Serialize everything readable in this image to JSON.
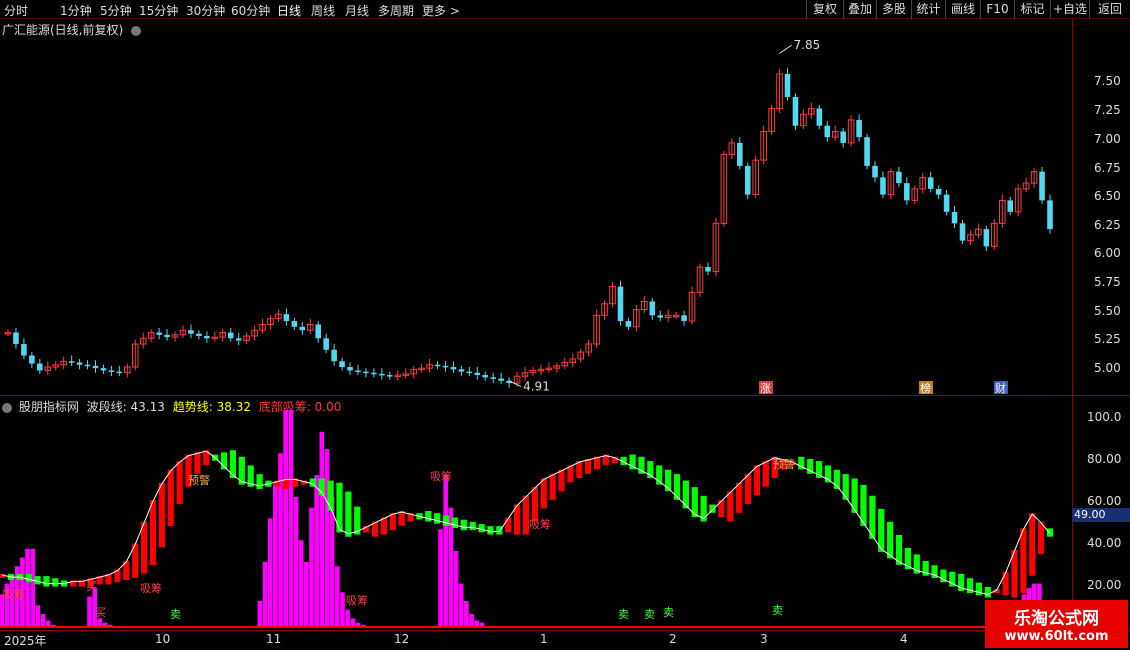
{
  "toolbar": {
    "timeframes": [
      "分时",
      "1分钟",
      "5分钟",
      "15分钟",
      "30分钟",
      "60分钟",
      "日线",
      "周线",
      "月线",
      "多周期",
      "更多 >"
    ],
    "active": "日线",
    "buttons": [
      "复权",
      "叠加",
      "多股",
      "统计",
      "画线",
      "F10",
      "标记",
      "+自选",
      "返回"
    ]
  },
  "price_panel": {
    "title": "广汇能源(日线,前复权)",
    "high_label": "7.85",
    "low_label": "4.91",
    "tags": [
      "涨",
      "榜",
      "财"
    ],
    "axis_labels": [
      "7.50",
      "7.25",
      "7.00",
      "6.75",
      "6.50",
      "6.25",
      "6.00",
      "5.75",
      "5.50",
      "5.25",
      "5.00"
    ]
  },
  "indicator_panel": {
    "name": "股朋指标网",
    "wave_label": "波段线:",
    "wave_value": "43.13",
    "trend_label": "趋势线:",
    "trend_value": "38.32",
    "bottom_label": "底部吸筹:",
    "bottom_value": "0.00",
    "axis_labels": [
      "100.0",
      "80.00",
      "60.00",
      "40.00",
      "20.00"
    ],
    "current_value": "49.00",
    "annotations": [
      "预警",
      "吸筹",
      "买",
      "卖"
    ]
  },
  "date_axis": [
    "2025年",
    "10",
    "11",
    "12",
    "1",
    "2",
    "3",
    "4"
  ],
  "watermark": {
    "line1": "乐淘公式网",
    "line2": "www.60lt.com"
  },
  "colors": {
    "up": "#ff3b3b",
    "down": "#54d8f0",
    "wave_up": "#ff0000",
    "wave_down": "#00ff00",
    "bottom": "#ff00ff"
  },
  "chart_data": [
    {
      "type": "candlestick",
      "title": "广汇能源(日线,前复权)",
      "ylim": [
        4.85,
        8.0
      ],
      "closes": [
        5.35,
        5.25,
        5.15,
        5.08,
        5.02,
        5.05,
        5.07,
        5.1,
        5.09,
        5.07,
        5.06,
        5.04,
        5.02,
        5.01,
        5.0,
        5.05,
        5.25,
        5.3,
        5.35,
        5.33,
        5.31,
        5.33,
        5.37,
        5.34,
        5.32,
        5.3,
        5.31,
        5.35,
        5.3,
        5.28,
        5.32,
        5.37,
        5.42,
        5.47,
        5.51,
        5.45,
        5.4,
        5.37,
        5.42,
        5.3,
        5.2,
        5.1,
        5.05,
        5.02,
        5.01,
        5.0,
        4.99,
        4.98,
        4.97,
        4.98,
        4.99,
        5.03,
        5.04,
        5.07,
        5.06,
        5.05,
        5.03,
        5.01,
        5.0,
        4.98,
        4.96,
        4.95,
        4.93,
        4.91,
        4.97,
        5.0,
        5.02,
        5.03,
        5.04,
        5.06,
        5.09,
        5.12,
        5.18,
        5.25,
        5.5,
        5.6,
        5.75,
        5.45,
        5.4,
        5.55,
        5.62,
        5.5,
        5.48,
        5.5,
        5.5,
        5.45,
        5.7,
        5.92,
        5.88,
        6.3,
        6.9,
        7.0,
        6.8,
        6.55,
        6.85,
        7.1,
        7.3,
        7.6,
        7.4,
        7.15,
        7.25,
        7.3,
        7.15,
        7.05,
        7.1,
        7.0,
        7.2,
        7.05,
        6.8,
        6.7,
        6.55,
        6.75,
        6.65,
        6.5,
        6.6,
        6.7,
        6.6,
        6.55,
        6.4,
        6.3,
        6.15,
        6.2,
        6.25,
        6.1,
        6.3,
        6.5,
        6.4,
        6.6,
        6.65,
        6.75,
        6.5,
        6.25
      ]
    },
    {
      "type": "line",
      "name": "波段线",
      "ylim": [
        0,
        100
      ],
      "values": [
        24,
        23,
        23,
        22,
        21,
        20,
        20,
        20,
        21,
        21,
        22,
        23,
        24,
        26,
        30,
        38,
        48,
        58,
        66,
        72,
        76,
        79,
        80,
        81,
        78,
        74,
        70,
        67,
        66,
        65,
        66,
        67,
        68,
        68,
        67,
        66,
        62,
        55,
        45,
        43,
        44,
        46,
        48,
        50,
        52,
        53,
        52,
        51,
        50,
        49,
        48,
        47,
        46,
        46,
        45,
        44,
        44,
        50,
        56,
        60,
        64,
        68,
        70,
        72,
        74,
        76,
        77,
        78,
        79,
        78,
        76,
        74,
        72,
        70,
        67,
        64,
        60,
        56,
        52,
        50,
        54,
        58,
        62,
        66,
        70,
        74,
        76,
        78,
        77,
        76,
        74,
        72,
        70,
        68,
        65,
        60,
        54,
        48,
        42,
        36,
        33,
        30,
        28,
        26,
        25,
        24,
        22,
        20,
        18,
        17,
        16,
        15,
        17,
        25,
        35,
        45,
        52,
        48,
        43
      ]
    },
    {
      "type": "bar",
      "name": "底部吸筹",
      "ylim": [
        0,
        100
      ],
      "values": [
        15,
        20,
        24,
        28,
        32,
        36,
        36,
        10,
        6,
        3,
        1,
        0,
        0,
        0,
        0,
        0,
        0,
        14,
        18,
        4,
        2,
        1,
        0,
        0,
        0,
        0,
        0,
        0,
        0,
        0,
        0,
        0,
        0,
        0,
        0,
        0,
        0,
        0,
        0,
        0,
        0,
        0,
        0,
        0,
        0,
        0,
        0,
        0,
        0,
        0,
        12,
        30,
        50,
        66,
        80,
        100,
        100,
        60,
        40,
        30,
        55,
        70,
        90,
        82,
        60,
        28,
        16,
        8,
        4,
        2,
        1,
        0,
        0,
        0,
        0,
        0,
        0,
        0,
        0,
        0,
        0,
        0,
        0,
        0,
        0,
        45,
        70,
        55,
        35,
        20,
        12,
        6,
        3,
        2,
        0,
        0,
        0,
        0,
        0,
        0,
        0,
        0,
        0,
        0,
        0,
        0,
        0,
        0,
        0,
        0,
        0,
        0,
        0,
        0,
        0,
        0,
        0,
        0,
        0,
        0,
        0,
        0,
        0,
        0,
        0,
        0,
        0,
        0,
        0,
        0,
        0,
        0,
        0,
        0,
        0,
        0,
        0,
        0,
        0,
        0,
        0,
        0,
        0,
        0,
        0,
        0,
        0,
        0,
        0,
        0,
        0,
        0,
        0,
        0,
        0,
        0,
        0,
        0,
        0,
        0,
        0,
        0,
        0,
        0,
        0,
        0,
        0,
        0,
        0,
        0,
        0,
        0,
        0,
        0,
        0,
        0,
        0,
        0,
        0,
        0,
        0,
        0,
        0,
        0,
        0,
        0,
        0,
        0,
        0,
        0,
        0,
        0,
        0,
        0,
        0,
        0,
        4,
        10,
        15,
        18,
        20,
        20,
        0,
        0
      ]
    }
  ]
}
